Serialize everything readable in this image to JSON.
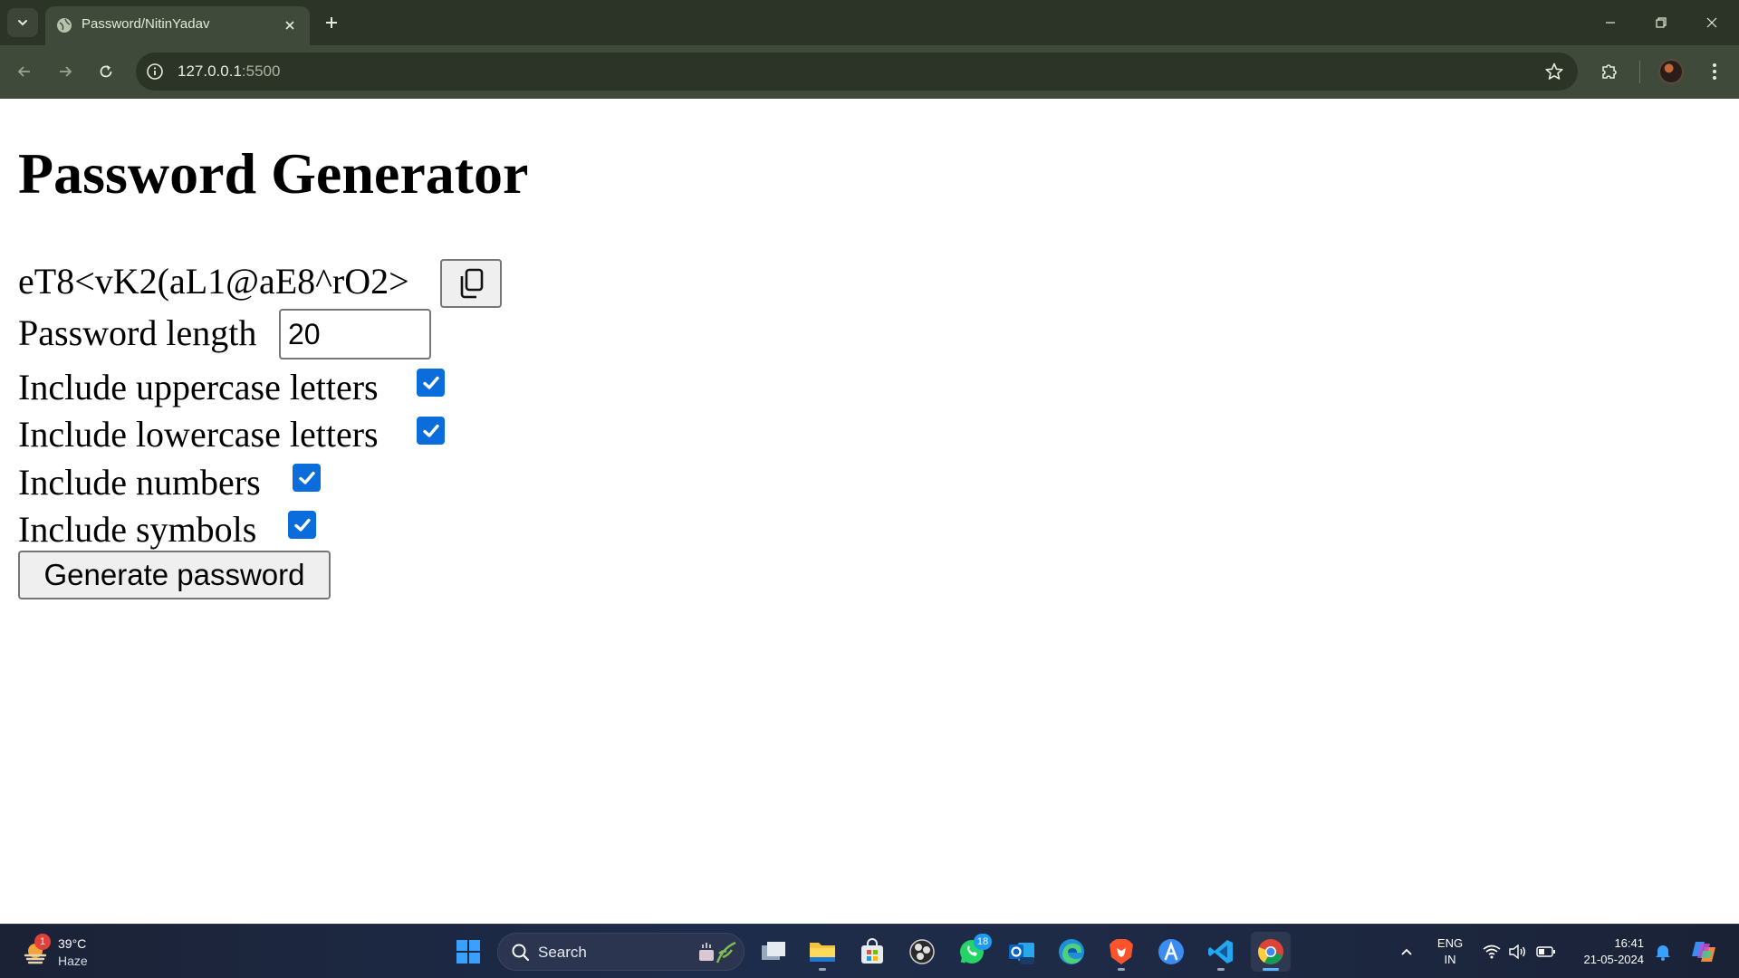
{
  "browser": {
    "tab_title": "Password/NitinYadav",
    "url_host": "127.0.0.1",
    "url_port": ":5500"
  },
  "page": {
    "title": "Password Generator",
    "password": "eT8<vK2(aL1@aE8^rO2>",
    "length_label": "Password length",
    "length_value": "20",
    "options": {
      "uppercase": {
        "label": "Include uppercase letters",
        "checked": true
      },
      "lowercase": {
        "label": "Include lowercase letters",
        "checked": true
      },
      "numbers": {
        "label": "Include numbers",
        "checked": true
      },
      "symbols": {
        "label": "Include symbols",
        "checked": true
      }
    },
    "generate_label": "Generate password"
  },
  "taskbar": {
    "weather_temp": "39°C",
    "weather_desc": "Haze",
    "weather_badge": "1",
    "search_label": "Search",
    "whatsapp_badge": "18",
    "lang_line1": "ENG",
    "lang_line2": "IN",
    "time": "16:41",
    "date": "21-05-2024"
  }
}
